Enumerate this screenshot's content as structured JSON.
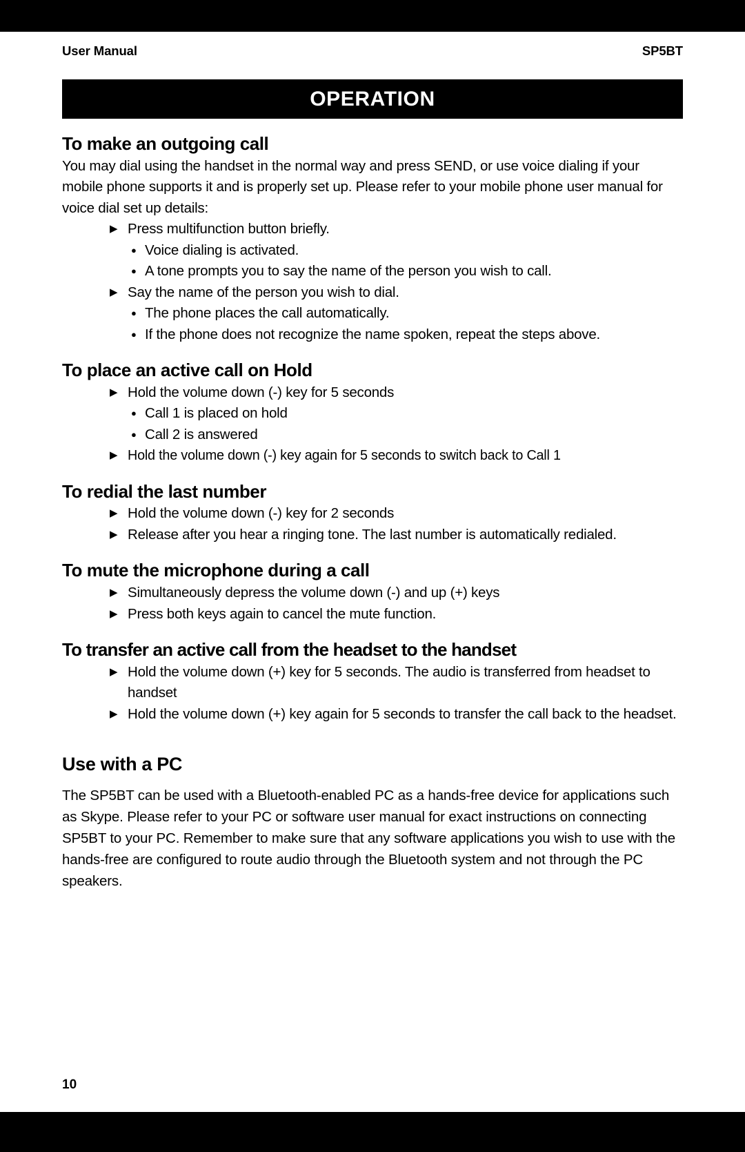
{
  "running_head": {
    "left": "User Manual",
    "right": "SP5BT"
  },
  "chapter_banner": {
    "title": "OPERATION"
  },
  "sections": {
    "outgoing_call": {
      "heading": "To make an outgoing call",
      "intro": "You may dial using the handset in the normal way and press SEND, or use voice dialing if your mobile phone supports it and is properly set up.  Please refer to your mobile phone user manual for voice dial set up details:",
      "steps": [
        "Press multifunction button briefly.",
        "Voice dialing is activated.",
        "A tone prompts you to say the name of the person you wish to call.",
        "Say the name of the person you wish to dial.",
        "The phone places the call automatically.",
        "If the phone does not recognize the name spoken, repeat the steps above."
      ]
    },
    "hold": {
      "heading": "To place an active call on Hold",
      "steps": [
        "Hold the volume down (-) key for 5 seconds",
        "Call 1 is placed on hold",
        "Call 2 is answered",
        "Hold the volume down (-) key again for 5 seconds to switch back to Call 1"
      ]
    },
    "redial": {
      "heading": "To redial the last number",
      "steps": [
        "Hold the volume down (-) key for 2 seconds",
        "Release after you hear a ringing tone. The last number is automatically redialed."
      ]
    },
    "mute": {
      "heading": "To mute the microphone during a call",
      "steps": [
        "Simultaneously depress the volume down (-) and up (+) keys",
        "Press both keys again to cancel the mute function."
      ]
    },
    "transfer": {
      "heading": "To transfer an active call from the headset to the handset",
      "steps": [
        "Hold the volume down (+) key for 5 seconds. The audio is transferred from headset to handset",
        "Hold the volume down (+) key again for 5 seconds to transfer the call back to the headset."
      ]
    },
    "use_with_pc": {
      "heading": "Use with a PC",
      "paragraph": "The SP5BT can be used with a Bluetooth-enabled PC as a hands-free device for applications such as Skype.  Please refer to your PC or software user manual for exact instructions on connecting SP5BT to your PC.  Remember to make sure that any software applications you wish to use with the hands-free are configured to route audio through the Bluetooth system and not through the PC speakers."
    }
  },
  "icons": {
    "triangle_bullet": "▶",
    "round_bullet": "●"
  },
  "footer": {
    "page_number": "10"
  },
  "colors": {
    "ink": "#000000",
    "paper": "#ffffff",
    "banner_bg": "#000000",
    "banner_text": "#ffffff"
  }
}
